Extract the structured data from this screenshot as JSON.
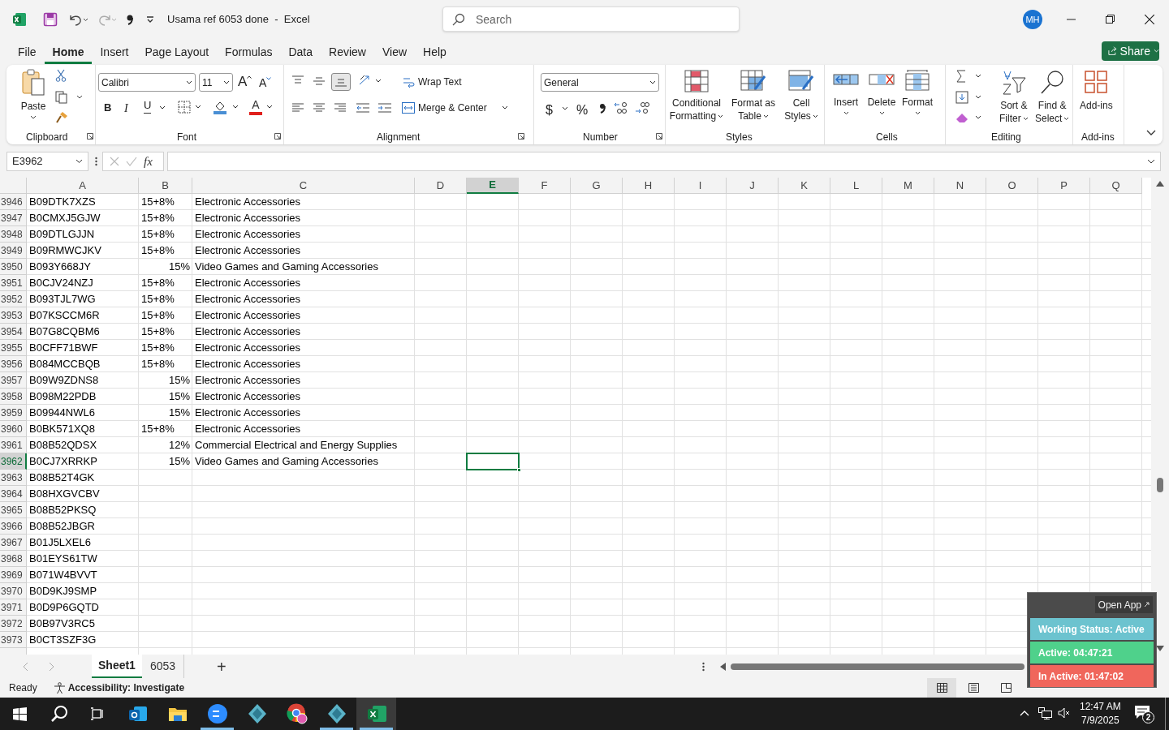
{
  "window": {
    "title": "Usama ref 6053 done  -  Excel",
    "search_placeholder": "Search",
    "avatar": "MH"
  },
  "tabs": [
    {
      "label": "File",
      "selected": false
    },
    {
      "label": "Home",
      "selected": true
    },
    {
      "label": "Insert",
      "selected": false
    },
    {
      "label": "Page Layout",
      "selected": false
    },
    {
      "label": "Formulas",
      "selected": false
    },
    {
      "label": "Data",
      "selected": false
    },
    {
      "label": "Review",
      "selected": false
    },
    {
      "label": "View",
      "selected": false
    },
    {
      "label": "Help",
      "selected": false
    }
  ],
  "share": "Share",
  "ribbon": {
    "clipboard": {
      "paste": "Paste",
      "label": "Clipboard"
    },
    "font": {
      "font": "Calibri",
      "size": "11",
      "grow": "A",
      "shrink": "A",
      "bold": "B",
      "italic": "I",
      "underline": "U",
      "font_letter": "A",
      "label": "Font"
    },
    "alignment": {
      "wrap": "Wrap Text",
      "merge": "Merge & Center",
      "label": "Alignment"
    },
    "number": {
      "format": "General",
      "currency": "$",
      "percent": "%",
      "label": "Number"
    },
    "styles": {
      "conditional": [
        "Conditional",
        "Formatting"
      ],
      "table": [
        "Format as",
        "Table"
      ],
      "cell": [
        "Cell",
        "Styles"
      ],
      "label": "Styles"
    },
    "cells": {
      "insert": "Insert",
      "delete": "Delete",
      "format": "Format",
      "label": "Cells"
    },
    "editing": {
      "sort": [
        "Sort &",
        "Filter"
      ],
      "find": [
        "Find &",
        "Select"
      ],
      "label": "Editing"
    },
    "addins": {
      "button": "Add-ins",
      "label": "Add-ins"
    }
  },
  "formula_bar": {
    "name_box": "E3962",
    "fx": "fx"
  },
  "columns": [
    {
      "label": "A",
      "selected": false
    },
    {
      "label": "B",
      "selected": false
    },
    {
      "label": "C",
      "selected": false
    },
    {
      "label": "D",
      "selected": false
    },
    {
      "label": "E",
      "selected": true
    },
    {
      "label": "F",
      "selected": false
    },
    {
      "label": "G",
      "selected": false
    },
    {
      "label": "H",
      "selected": false
    },
    {
      "label": "I",
      "selected": false
    },
    {
      "label": "J",
      "selected": false
    },
    {
      "label": "K",
      "selected": false
    },
    {
      "label": "L",
      "selected": false
    },
    {
      "label": "M",
      "selected": false
    },
    {
      "label": "N",
      "selected": false
    },
    {
      "label": "O",
      "selected": false
    },
    {
      "label": "P",
      "selected": false
    },
    {
      "label": "Q",
      "selected": false
    }
  ],
  "rows": [
    {
      "row": "3946",
      "a": "B09DTK7XZS",
      "b": {
        "text": "15+8%",
        "kind": "text"
      },
      "c": "Electronic Accessories",
      "selected": false
    },
    {
      "row": "3947",
      "a": "B0CMXJ5GJW",
      "b": {
        "text": "15+8%",
        "kind": "text"
      },
      "c": "Electronic Accessories",
      "selected": false
    },
    {
      "row": "3948",
      "a": "B09DTLGJJN",
      "b": {
        "text": "15+8%",
        "kind": "text"
      },
      "c": "Electronic Accessories",
      "selected": false
    },
    {
      "row": "3949",
      "a": "B09RMWCJKV",
      "b": {
        "text": "15+8%",
        "kind": "text"
      },
      "c": "Electronic Accessories",
      "selected": false
    },
    {
      "row": "3950",
      "a": "B093Y668JY",
      "b": {
        "text": "15%",
        "kind": "number"
      },
      "c": "Video Games and Gaming Accessories",
      "selected": false
    },
    {
      "row": "3951",
      "a": "B0CJV24NZJ",
      "b": {
        "text": "15+8%",
        "kind": "text"
      },
      "c": "Electronic Accessories",
      "selected": false
    },
    {
      "row": "3952",
      "a": "B093TJL7WG",
      "b": {
        "text": "15+8%",
        "kind": "text"
      },
      "c": "Electronic Accessories",
      "selected": false
    },
    {
      "row": "3953",
      "a": "B07KSCCM6R",
      "b": {
        "text": "15+8%",
        "kind": "text"
      },
      "c": "Electronic Accessories",
      "selected": false
    },
    {
      "row": "3954",
      "a": "B07G8CQBM6",
      "b": {
        "text": "15+8%",
        "kind": "text"
      },
      "c": "Electronic Accessories",
      "selected": false
    },
    {
      "row": "3955",
      "a": "B0CFF71BWF",
      "b": {
        "text": "15+8%",
        "kind": "text"
      },
      "c": "Electronic Accessories",
      "selected": false
    },
    {
      "row": "3956",
      "a": "B084MCCBQB",
      "b": {
        "text": "15+8%",
        "kind": "text"
      },
      "c": "Electronic Accessories",
      "selected": false
    },
    {
      "row": "3957",
      "a": "B09W9ZDNS8",
      "b": {
        "text": "15%",
        "kind": "number"
      },
      "c": "Electronic Accessories",
      "selected": false
    },
    {
      "row": "3958",
      "a": "B098M22PDB",
      "b": {
        "text": "15%",
        "kind": "number"
      },
      "c": "Electronic Accessories",
      "selected": false
    },
    {
      "row": "3959",
      "a": "B09944NWL6",
      "b": {
        "text": "15%",
        "kind": "number"
      },
      "c": "Electronic Accessories",
      "selected": false
    },
    {
      "row": "3960",
      "a": "B0BK571XQ8",
      "b": {
        "text": "15+8%",
        "kind": "text"
      },
      "c": "Electronic Accessories",
      "selected": false
    },
    {
      "row": "3961",
      "a": "B08B52QDSX",
      "b": {
        "text": "12%",
        "kind": "number"
      },
      "c": "Commercial Electrical and Energy Supplies",
      "selected": false
    },
    {
      "row": "3962",
      "a": "B0CJ7XRRKP",
      "b": {
        "text": "15%",
        "kind": "number"
      },
      "c": "Video Games and Gaming Accessories",
      "selected": true
    },
    {
      "row": "3963",
      "a": "B08B52T4GK",
      "selected": false
    },
    {
      "row": "3964",
      "a": "B08HXGVCBV",
      "selected": false
    },
    {
      "row": "3965",
      "a": "B08B52PKSQ",
      "selected": false
    },
    {
      "row": "3966",
      "a": "B08B52JBGR",
      "selected": false
    },
    {
      "row": "3967",
      "a": "B01J5LXEL6",
      "selected": false
    },
    {
      "row": "3968",
      "a": "B01EYS61TW",
      "selected": false
    },
    {
      "row": "3969",
      "a": "B071W4BVVT",
      "selected": false
    },
    {
      "row": "3970",
      "a": "B0D9KJ9SMP",
      "selected": false
    },
    {
      "row": "3971",
      "a": "B0D9P6GQTD",
      "selected": false
    },
    {
      "row": "3972",
      "a": "B0B97V3RC5",
      "selected": false
    },
    {
      "row": "3973",
      "a": "B0CT3SZF3G",
      "selected": false
    }
  ],
  "sheets": [
    {
      "label": "Sheet1",
      "selected": true
    },
    {
      "label": "6053",
      "selected": false
    }
  ],
  "add_sheet": "+",
  "status_bar": {
    "ready": "Ready",
    "accessibility": "Accessibility: Investigate"
  },
  "tracker": {
    "open_app": "Open App",
    "items": [
      {
        "text": "Working Status: Active",
        "color": "#6cc3cf"
      },
      {
        "text": "Active: 04:47:21",
        "color": "#4fd18b"
      },
      {
        "text": "In Active: 01:47:02",
        "color": "#f0665c"
      }
    ]
  },
  "taskbar": {
    "apps": [
      {
        "running": false,
        "selected": false
      },
      {
        "running": false,
        "selected": false
      },
      {
        "running": true,
        "selected": false
      },
      {
        "running": false,
        "selected": false
      },
      {
        "running": false,
        "selected": false
      },
      {
        "running": true,
        "selected": false
      },
      {
        "running": true,
        "selected": true
      }
    ],
    "time": "12:47 AM",
    "date": "7/9/2025",
    "notifications": "2"
  }
}
